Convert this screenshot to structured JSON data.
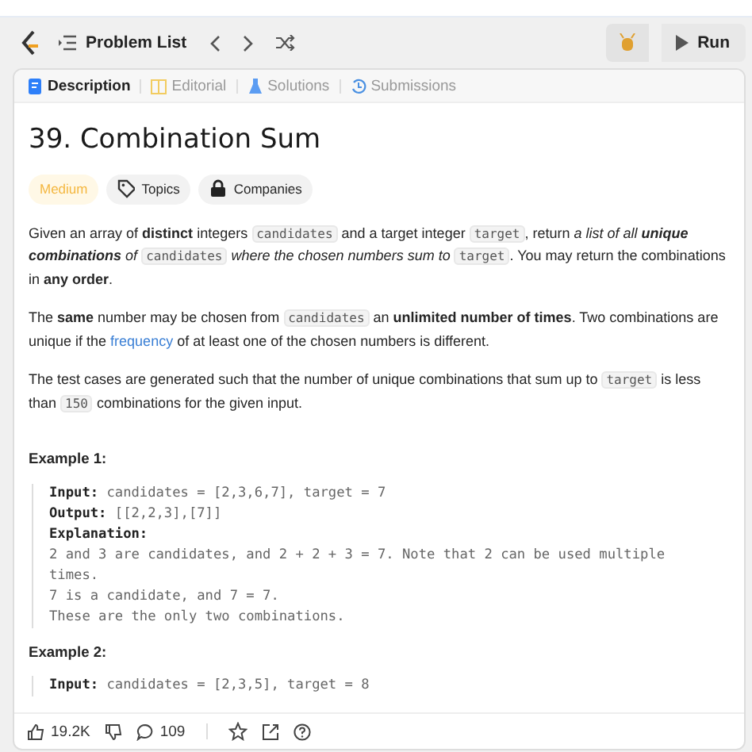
{
  "header": {
    "problem_list": "Problem List",
    "run_button": "Run"
  },
  "tabs": [
    {
      "label": "Description",
      "kind": "doc",
      "selected": true
    },
    {
      "label": "Editorial",
      "kind": "book",
      "selected": false
    },
    {
      "label": "Solutions",
      "kind": "flask",
      "selected": false
    },
    {
      "label": "Submissions",
      "kind": "history",
      "selected": false
    }
  ],
  "problem": {
    "title": "39. Combination Sum",
    "difficulty": "Medium",
    "tags": [
      {
        "label": "Topics",
        "kind": "tag"
      },
      {
        "label": "Companies",
        "kind": "lock"
      }
    ]
  },
  "paragraphs": [
    [
      {
        "kind": "text",
        "text": "Given an array of **distinct** integers "
      },
      {
        "kind": "code",
        "text": "candidates"
      },
      {
        "kind": "text",
        "text": " and a target integer "
      },
      {
        "kind": "code",
        "text": "target"
      },
      {
        "kind": "text",
        "text": ", return *a list of all* "
      },
      {
        "kind": "strong-em",
        "text": "unique combinations"
      },
      {
        "kind": "text",
        "text": " *of* "
      },
      {
        "kind": "code",
        "text": "candidates"
      },
      {
        "kind": "text",
        "text": " *where the chosen numbers sum to* "
      },
      {
        "kind": "code",
        "text": "target"
      },
      {
        "kind": "text",
        "text": ". You may return the combinations in **any order**."
      }
    ],
    [
      {
        "kind": "text",
        "text": "The **same** number may be chosen from "
      },
      {
        "kind": "code",
        "text": "candidates"
      },
      {
        "kind": "text",
        "text": " an **unlimited number of times**. Two combinations are unique if the "
      },
      {
        "kind": "link",
        "text": "frequency"
      },
      {
        "kind": "text",
        "text": " of at least one of the chosen numbers is different."
      }
    ],
    [
      {
        "kind": "text",
        "text": "The test cases are generated such that the number of unique combinations that sum up to "
      },
      {
        "kind": "code",
        "text": "target"
      },
      {
        "kind": "text",
        "text": " is less than "
      },
      {
        "kind": "code",
        "text": "150"
      },
      {
        "kind": "text",
        "text": " combinations for the given input."
      }
    ]
  ],
  "examples": [
    {
      "title": "Example 1:",
      "lines": [
        {
          "label": "Input:",
          "value": "candidates = [2,3,6,7], target = 7"
        },
        {
          "label": "Output:",
          "value": "[[2,2,3],[7]]"
        },
        {
          "label": "Explanation:"
        },
        {
          "value": "2 and 3 are candidates, and 2 + 2 + 3 = 7. Note that 2 can be used multiple times."
        },
        {
          "value": "7 is a candidate, and 7 = 7."
        },
        {
          "value": "These are the only two combinations."
        }
      ]
    },
    {
      "title": "Example 2:",
      "lines": [
        {
          "label": "Input:",
          "value": "candidates = [2,3,5], target = 8"
        }
      ]
    }
  ],
  "footer": {
    "likes": "19.2K",
    "comments": "109"
  }
}
